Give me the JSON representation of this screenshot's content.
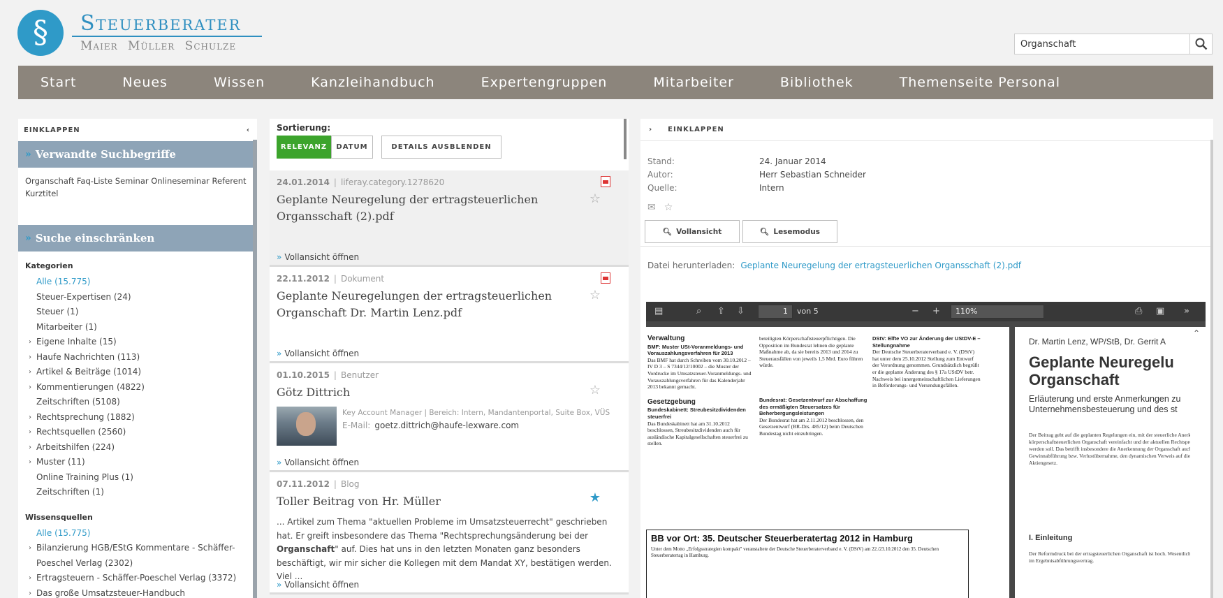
{
  "brand": {
    "symbol": "§",
    "title": "Steuerberater",
    "subtitle": "Maier Müller Schulze",
    "color": "#2f8fc0"
  },
  "search": {
    "value": "Organschaft",
    "icon": "search-icon"
  },
  "nav": [
    "Start",
    "Neues",
    "Wissen",
    "Kanzleihandbuch",
    "Expertengruppen",
    "Mitarbeiter",
    "Bibliothek",
    "Themenseite Personal"
  ],
  "left": {
    "collapse_label": "EINKLAPPEN",
    "collapse_icon": "‹",
    "related_title": "Verwandte Suchbegriffe",
    "related_terms": "Organschaft Faq-Liste Seminar Onlineseminar Referent Kurztitel",
    "filter_title": "Suche einschränken",
    "categories_label": "Kategorien",
    "categories": [
      {
        "label": "Alle (15.775)",
        "active": true,
        "expandable": false
      },
      {
        "label": "Steuer-Expertisen (24)",
        "active": false,
        "expandable": false
      },
      {
        "label": "Steuer (1)",
        "active": false,
        "expandable": false
      },
      {
        "label": "Mitarbeiter (1)",
        "active": false,
        "expandable": false
      },
      {
        "label": "Eigene Inhalte (15)",
        "active": false,
        "expandable": true
      },
      {
        "label": "Haufe Nachrichten (113)",
        "active": false,
        "expandable": true
      },
      {
        "label": "Artikel & Beiträge (1014)",
        "active": false,
        "expandable": true
      },
      {
        "label": "Kommentierungen (4822)",
        "active": false,
        "expandable": true
      },
      {
        "label": "Zeitschriften (5108)",
        "active": false,
        "expandable": false
      },
      {
        "label": "Rechtsprechung (1882)",
        "active": false,
        "expandable": true
      },
      {
        "label": "Rechtsquellen (2560)",
        "active": false,
        "expandable": true
      },
      {
        "label": "Arbeitshilfen (224)",
        "active": false,
        "expandable": true
      },
      {
        "label": "Muster (11)",
        "active": false,
        "expandable": true
      },
      {
        "label": "Online Training Plus (1)",
        "active": false,
        "expandable": false
      },
      {
        "label": "Zeitschriften (1)",
        "active": false,
        "expandable": false
      }
    ],
    "sources_label": "Wissensquellen",
    "sources": [
      {
        "label": "Alle (15.775)",
        "active": true,
        "expandable": false
      },
      {
        "label": "Bilanzierung HGB/EStG Kommentare - Schäffer-",
        "active": false,
        "expandable": true
      },
      {
        "label": "Poeschel Verlag (2302)",
        "active": false,
        "expandable": false
      },
      {
        "label": "Ertragsteuern - Schäffer-Poeschel Verlag (3372)",
        "active": false,
        "expandable": true
      },
      {
        "label": "Das große Umsatzsteuer-Handbuch",
        "active": false,
        "expandable": true
      }
    ]
  },
  "middle": {
    "sort_label": "Sortierung:",
    "sort_relevance": "RELEVANZ",
    "sort_date": "DATUM",
    "details_hide": "DETAILS AUSBLENDEN",
    "open_label": "Vollansicht öffnen",
    "results": [
      {
        "date": "24.01.2014",
        "type": "liferay.category.1278620",
        "title": "Geplante Neuregelung der ertragsteuerlichen Organsschaft (2).pdf",
        "pdf": true,
        "starred": false
      },
      {
        "date": "22.11.2012",
        "type": "Dokument",
        "title": "Geplante Neuregelungen der ertragsteuerlichen Organschaft Dr. Martin Lenz.pdf",
        "pdf": true,
        "starred": false
      },
      {
        "date": "01.10.2015",
        "type": "Benutzer",
        "title": "Götz Dittrich",
        "role": "Key Account Manager | Bereich: Intern, Mandantenportal, Suite Box, VÜS",
        "email_label": "E-Mail:",
        "email": "goetz.dittrich@haufe-lexware.com",
        "starred": false
      },
      {
        "date": "07.11.2012",
        "type": "Blog",
        "title": "Toller Beitrag von Hr. Müller",
        "body_pre": "... Artikel zum Thema \"aktuellen Probleme im Umsatzsteuerrecht\" geschrieben hat. Er greift insbesondere das Thema \"Rechtsprechungsänderung bei der ",
        "body_bold": "Organschaft",
        "body_post": "\" auf. Dies hat uns in den letzten Monaten ganz besonders beschäftigt, wir mir sicher die Kollegen mit dem Mandat XY, bestätigen werden. Viel ...",
        "starred": true
      }
    ]
  },
  "right": {
    "collapse_label": "EINKLAPPEN",
    "meta": [
      {
        "k": "Stand:",
        "v": "24. Januar 2014"
      },
      {
        "k": "Autor:",
        "v": "Herr Sebastian Schneider"
      },
      {
        "k": "Quelle:",
        "v": "Intern"
      }
    ],
    "full_view": "Vollansicht",
    "read_mode": "Lesemodus",
    "download_label": "Datei herunterladen:",
    "download_link": "Geplante Neuregelung der ertragsteuerlichen Organsschaft (2).pdf",
    "viewer": {
      "page": "1",
      "page_of": "von 5",
      "zoom": "110%",
      "p1": {
        "c1_h": "Verwaltung",
        "c1_b1": "BMF: Muster USt-Voranmeldungs- und Vorauszahlungsverfahren für 2013",
        "c1_t1": "Das BMF hat durch Schreiben vom 30.10.2012 – IV D 3 – S 7344/12/10002 – die Muster der Vordrucke im Umsatzsteuer-Voranmeldungs- und Vorauszahlungsverfahren für das Kalenderjahr 2013 bekannt gemacht.",
        "c1_h2": "Gesetzgebung",
        "c1_b2": "Bundeskabinett: Streubesitzdividenden steuerfrei",
        "c1_t2": "Das Bundeskabinett hat am 31.10.2012 beschlossen, Streubesitzdividenden auch für ausländische Kapitalgesellschaften steuerfrei zu stellen.",
        "c2_t1": "beteiligten Körperschaftsteuerpflichtigen. Die Opposition im Bundesrat lehnen die geplante Maßnahme ab, da sie bereits 2013 und 2014 zu Steuerausfällen von jeweils 1,5 Mrd. Euro führen würde.",
        "c2_b": "Bundesrat: Gesetzentwurf zur Abschaffung des ermäßigten Steuersatzes für Beherbergungsleistungen",
        "c2_t2": "Der Bundesrat hat am 2.11.2012 beschlossen, den Gesetzentwurf (BR-Drs. 485/12) beim Deutschen Bundestag nicht einzubringen.",
        "c3_b": "DStV: Elfte VO zur Änderung der UStDV-E – Stellungnahme",
        "c3_t": "Der Deutsche Steuerberaterverband e. V. (DStV) hat unter dem 25.10.2012 Stellung zum Entwurf der Verordnung genommen. Grundsätzlich begrüßt er die geplante Änderung des § 17a UStDV betr. Nachweis bei innergemeinschaftlichen Lieferungen in Beförderungs- und Versendungsfällen.",
        "box_title": "BB vor Ort: 35. Deutscher Steuerberatertag 2012 in Hamburg",
        "box_text": "Unter dem Motto „Erfolgsstrategien kompakt\" veranstaltete der Deutsche Steuerberaterverband e. V. (DStV) am 22./23.10.2012 den 35. Deutschen Steuerberatertag in Hamburg."
      },
      "p2": {
        "author": "Dr. Martin Lenz, WP/StB, Dr. Gerrit A",
        "title1": "Geplante Neuregelu",
        "title2": "Organschaft",
        "sub1": "Erläuterung und erste Anmerkungen zu",
        "sub2": "Unternehmensbesteuerung und des st",
        "body": "Der Beitrag geht auf die geplanten Regelungen ein, mit der steuerliche Anerkennung der körperschaftsteuerlichen Organschaft vereinfacht und der aktuellen Rechtsprechung angepasst werden soll. Das betrifft insbesondere die Anerkennung der Organschaft auch bei einer fehlerhaften Gewinnabführung bzw. Verlustübernahme, den dynamischen Verweis auf die Verlustübernahme im Aktiengesetz.",
        "heading": "I. Einleitung",
        "body2": "Der Reformdruck bei der ertragsteuerlichen Organschaft ist hoch. Wesentliche Gründe dafür liegen im Ergebnisabführungsvertrag."
      }
    }
  }
}
